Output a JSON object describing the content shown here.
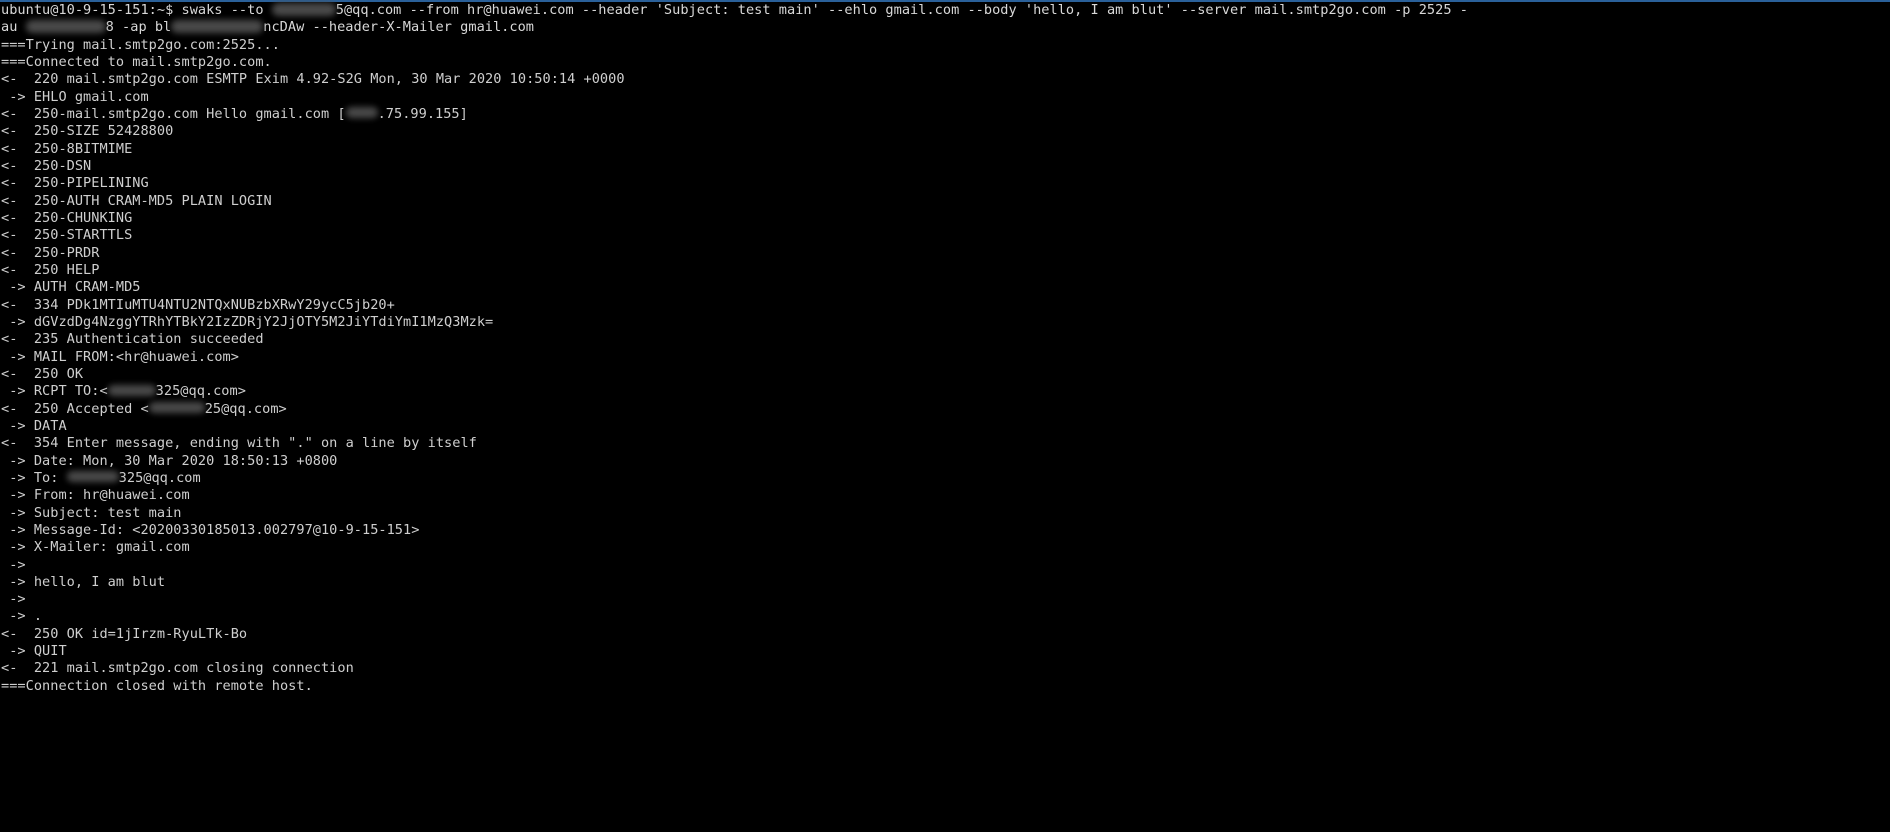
{
  "window": {
    "title": "ubuntu@10-9-15-151: ~",
    "background_color": "#000000",
    "text_color": "#cfcfcf",
    "accent_color": "#2a6099"
  },
  "prompt": {
    "user_host": "ubuntu@10-9-15-151",
    "path": "~",
    "symbol": "$"
  },
  "command": {
    "name": "swaks",
    "line1_pre": "ubuntu@10-9-15-151:~$ swaks --to ",
    "to_suffix": "5@qq.com",
    "line1_post": " --from hr@huawei.com --header 'Subject: test main' --ehlo gmail.com --body 'hello, I am blut' --server mail.smtp2go.com -p 2525 -",
    "line2_pre": "au ",
    "line2_mid": "8 -ap bl",
    "line2_post": "ncDAw --header-X-Mailer gmail.com"
  },
  "log": {
    "lines": [
      {
        "tag": "===",
        "text": "Trying mail.smtp2go.com:2525..."
      },
      {
        "tag": "===",
        "text": "Connected to mail.smtp2go.com."
      },
      {
        "tag": "<- ",
        "text": " 220 mail.smtp2go.com ESMTP Exim 4.92-S2G Mon, 30 Mar 2020 10:50:14 +0000"
      },
      {
        "tag": " ->",
        "text": " EHLO gmail.com"
      },
      {
        "tag": "<- ",
        "text": " 250-mail.smtp2go.com Hello gmail.com [",
        "redacted": true,
        "text2": ".75.99.155]"
      },
      {
        "tag": "<- ",
        "text": " 250-SIZE 52428800"
      },
      {
        "tag": "<- ",
        "text": " 250-8BITMIME"
      },
      {
        "tag": "<- ",
        "text": " 250-DSN"
      },
      {
        "tag": "<- ",
        "text": " 250-PIPELINING"
      },
      {
        "tag": "<- ",
        "text": " 250-AUTH CRAM-MD5 PLAIN LOGIN"
      },
      {
        "tag": "<- ",
        "text": " 250-CHUNKING"
      },
      {
        "tag": "<- ",
        "text": " 250-STARTTLS"
      },
      {
        "tag": "<- ",
        "text": " 250-PRDR"
      },
      {
        "tag": "<- ",
        "text": " 250 HELP"
      },
      {
        "tag": " ->",
        "text": " AUTH CRAM-MD5"
      },
      {
        "tag": "<- ",
        "text": " 334 PDk1MTIuMTU4NTU2NTQxNUBzbXRwY29ycC5jb20+"
      },
      {
        "tag": " ->",
        "text": " dGVzdDg4NzggYTRhYTBkY2IzZDRjY2JjOTY5M2JiYTdiYmI1MzQ3Mzk="
      },
      {
        "tag": "<- ",
        "text": " 235 Authentication succeeded"
      },
      {
        "tag": " ->",
        "text": " MAIL FROM:<hr@huawei.com>"
      },
      {
        "tag": "<- ",
        "text": " 250 OK"
      },
      {
        "tag": " ->",
        "text": " RCPT TO:<",
        "redacted": true,
        "text2": "325@qq.com>"
      },
      {
        "tag": "<- ",
        "text": " 250 Accepted <",
        "redacted": true,
        "text2": "25@qq.com>"
      },
      {
        "tag": " ->",
        "text": " DATA"
      },
      {
        "tag": "<- ",
        "text": " 354 Enter message, ending with \".\" on a line by itself"
      },
      {
        "tag": " ->",
        "text": " Date: Mon, 30 Mar 2020 18:50:13 +0800"
      },
      {
        "tag": " ->",
        "text": " To: ",
        "redacted": true,
        "text2": "325@qq.com"
      },
      {
        "tag": " ->",
        "text": " From: hr@huawei.com"
      },
      {
        "tag": " ->",
        "text": " Subject: test main"
      },
      {
        "tag": " ->",
        "text": " Message-Id: <20200330185013.002797@10-9-15-151>"
      },
      {
        "tag": " ->",
        "text": " X-Mailer: gmail.com"
      },
      {
        "tag": " ->",
        "text": ""
      },
      {
        "tag": " ->",
        "text": " hello, I am blut"
      },
      {
        "tag": " ->",
        "text": ""
      },
      {
        "tag": " ->",
        "text": " ."
      },
      {
        "tag": "<- ",
        "text": " 250 OK id=1jIrzm-RyuLTk-Bo"
      },
      {
        "tag": " ->",
        "text": " QUIT"
      },
      {
        "tag": "<- ",
        "text": " 221 mail.smtp2go.com closing connection"
      },
      {
        "tag": "===",
        "text": "Connection closed with remote host."
      }
    ]
  }
}
